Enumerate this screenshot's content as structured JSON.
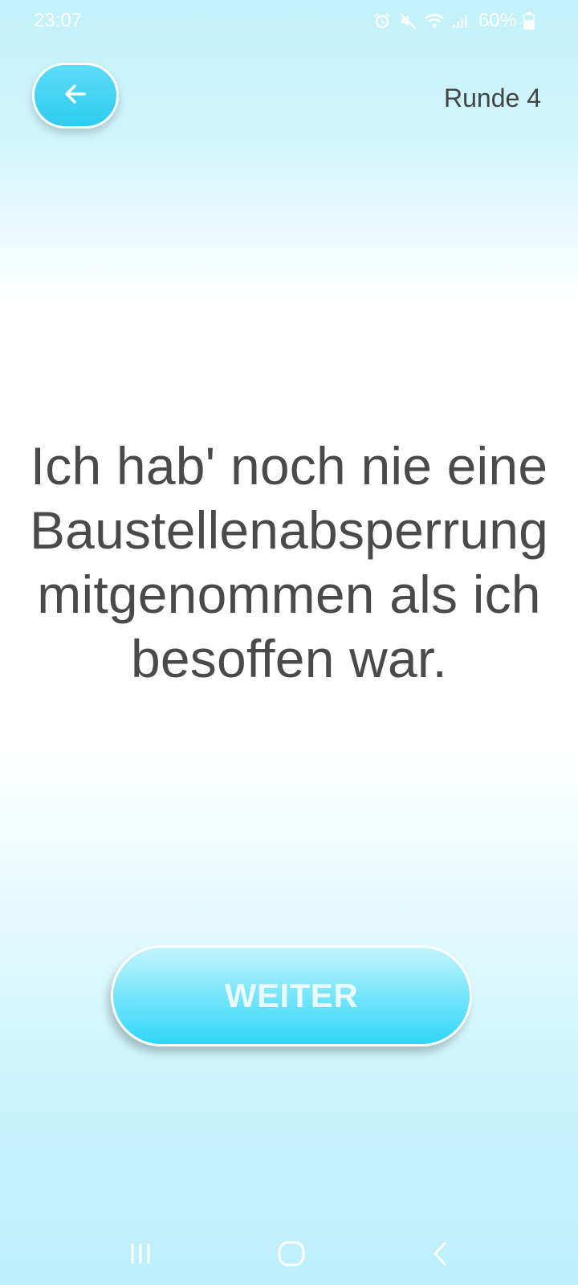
{
  "status_bar": {
    "time": "23:07",
    "battery_percent": "60%",
    "icons": [
      "alarm-icon",
      "mute-icon",
      "wifi-icon",
      "signal-icon",
      "battery-icon"
    ]
  },
  "header": {
    "back_icon": "arrow-left-icon",
    "round_label": "Runde 4"
  },
  "card": {
    "statement": "Ich hab' noch nie eine Baustellenabsperrung mitgenommen als ich besoffen war."
  },
  "actions": {
    "next_label": "WEITER"
  },
  "nav_bar": {
    "icons": [
      "recent-apps-icon",
      "home-icon",
      "back-nav-icon"
    ]
  },
  "colors": {
    "accent": "#2fcbf0",
    "text": "#4a4a4a"
  }
}
